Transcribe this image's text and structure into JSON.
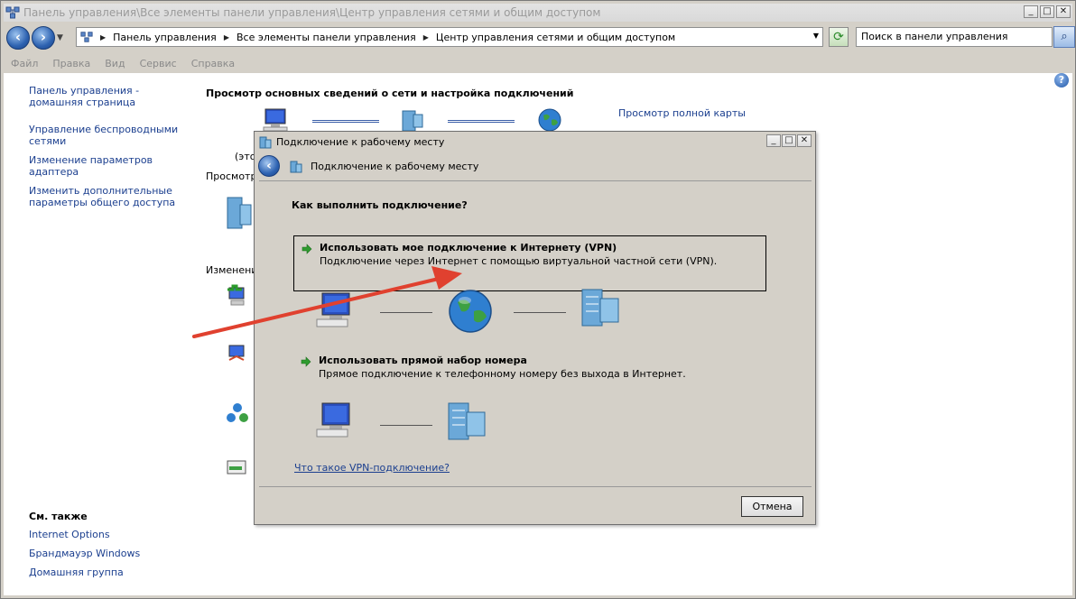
{
  "window": {
    "title": "Панель управления\\Все элементы панели управления\\Центр управления сетями и общим доступом",
    "minimize": "_",
    "maximize": "□",
    "close": "✕"
  },
  "address": {
    "crumbs": [
      "Панель управления",
      "Все элементы панели управления",
      "Центр управления сетями и общим доступом"
    ],
    "search_placeholder": "Поиск в панели управления"
  },
  "menu": [
    "Файл",
    "Правка",
    "Вид",
    "Сервис",
    "Справка"
  ],
  "left": {
    "links": [
      "Панель управления - домашняя страница",
      "Управление беспроводными сетями",
      "Изменение параметров адаптера",
      "Изменить дополнительные параметры общего доступа"
    ],
    "see_also_title": "См. также",
    "see_also": [
      "Internet Options",
      "Брандмауэр Windows",
      "Домашняя группа"
    ]
  },
  "main": {
    "heading": "Просмотр основных сведений о сети и настройка подключений",
    "full_map": "Просмотр полной карты",
    "partial_1": "(этот",
    "partial_2": "Просмотр а",
    "partial_3": "Изменение"
  },
  "dialog": {
    "title": "Подключение к рабочему месту",
    "nav_title": "Подключение к рабочему месту",
    "question": "Как выполнить подключение?",
    "option1_title": "Использовать мое подключение к Интернету (VPN)",
    "option1_desc": "Подключение через Интернет с помощью виртуальной частной сети (VPN).",
    "option2_title": "Использовать прямой набор номера",
    "option2_desc": "Прямое подключение к телефонному номеру без выхода в Интернет.",
    "link": "Что такое VPN-подключение?",
    "cancel": "Отмена"
  },
  "colors": {
    "link": "#1b3f8f",
    "annotation_arrow": "#e0412f"
  }
}
